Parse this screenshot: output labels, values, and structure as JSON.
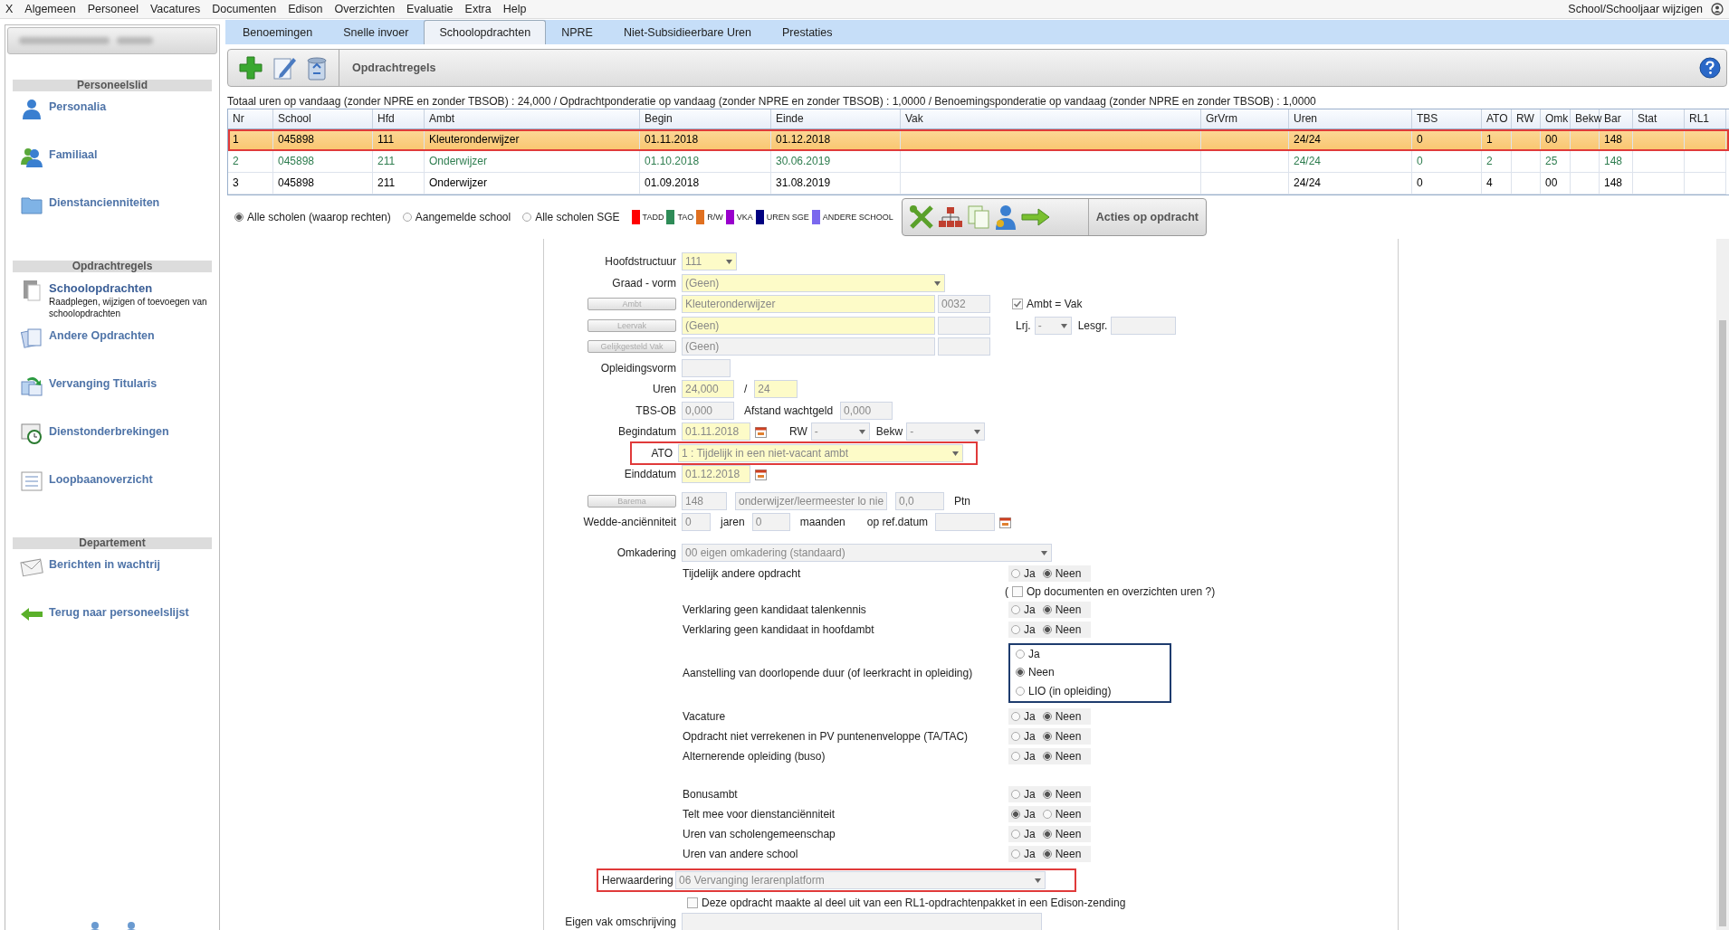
{
  "menu": [
    "X",
    "Algemeen",
    "Personeel",
    "Vacatures",
    "Documenten",
    "Edison",
    "Overzichten",
    "Evaluatie",
    "Extra",
    "Help"
  ],
  "user_link": "School/Schooljaar wijzigen",
  "sidebar": {
    "sections": [
      {
        "title": "Personeelslid",
        "items": [
          {
            "label": "Personalia",
            "selected": false
          },
          {
            "label": "Familiaal",
            "selected": false
          },
          {
            "label": "Dienstancienniteiten",
            "selected": false
          }
        ]
      },
      {
        "title": "Opdrachtregels",
        "items": [
          {
            "label": "Schoolopdrachten",
            "description": "Raadplegen, wijzigen of toevoegen van schoolopdrachten",
            "selected": true
          },
          {
            "label": "Andere Opdrachten",
            "selected": false
          },
          {
            "label": "Vervanging Titularis",
            "selected": false
          },
          {
            "label": "Dienstonderbrekingen",
            "selected": false
          },
          {
            "label": "Loopbaanoverzicht",
            "selected": false
          }
        ]
      },
      {
        "title": "Departement",
        "items": [
          {
            "label": "Berichten in wachtrij",
            "selected": false
          },
          {
            "label": "Terug naar personeelslijst",
            "selected": false
          }
        ]
      }
    ]
  },
  "tabs": [
    {
      "label": "Benoemingen",
      "selected": false
    },
    {
      "label": "Snelle invoer",
      "selected": false
    },
    {
      "label": "Schoolopdrachten",
      "selected": true
    },
    {
      "label": "NPRE",
      "selected": false
    },
    {
      "label": "Niet-Subsidieerbare Uren",
      "selected": false
    },
    {
      "label": "Prestaties",
      "selected": false
    }
  ],
  "toolbar": {
    "title": "Opdrachtregels"
  },
  "summary": "Totaal uren op vandaag (zonder NPRE en zonder TBSOB) : 24,000 / Opdrachtponderatie op vandaag (zonder NPRE en zonder TBSOB) : 1,0000 / Benoemingsponderatie op vandaag (zonder NPRE en zonder TBSOB) : 1,0000",
  "table": {
    "columns": [
      "Nr",
      "School",
      "Hfd",
      "Ambt",
      "Begin",
      "Einde",
      "Vak",
      "GrVrm",
      "Uren",
      "TBS",
      "ATO",
      "RW",
      "Omk",
      "Bekw",
      "Bar",
      "Stat",
      "RL1"
    ],
    "rows": [
      {
        "cells": [
          "1",
          "045898",
          "111",
          "Kleuteronderwijzer",
          "01.11.2018",
          "01.12.2018",
          "",
          "",
          "24/24",
          "0",
          "1",
          "",
          "00",
          "",
          "148",
          "",
          ""
        ],
        "selected": true,
        "marked": true,
        "color": "#000000"
      },
      {
        "cells": [
          "2",
          "045898",
          "211",
          "Onderwijzer",
          "01.10.2018",
          "30.06.2019",
          "",
          "",
          "24/24",
          "0",
          "2",
          "",
          "25",
          "",
          "148",
          "",
          ""
        ],
        "selected": false,
        "marked": false,
        "color": "#2e7d4f"
      },
      {
        "cells": [
          "3",
          "045898",
          "211",
          "Onderwijzer",
          "01.09.2018",
          "31.08.2019",
          "",
          "",
          "24/24",
          "0",
          "4",
          "",
          "00",
          "",
          "148",
          "",
          ""
        ],
        "selected": false,
        "marked": false,
        "color": "#000000"
      }
    ]
  },
  "school_filter": [
    {
      "label": "Alle scholen (waarop rechten)",
      "selected": true
    },
    {
      "label": "Aangemelde school",
      "selected": false
    },
    {
      "label": "Alle scholen SGE",
      "selected": false
    }
  ],
  "legend": [
    {
      "label": "TADD",
      "color": "#ff0000"
    },
    {
      "label": "TAO",
      "color": "#2e8b57"
    },
    {
      "label": "R/W",
      "color": "#e07020"
    },
    {
      "label": "VKA",
      "color": "#9900cc"
    },
    {
      "label": "UREN SGE",
      "color": "#000080"
    },
    {
      "label": "ANDERE SCHOOL",
      "color": "#7b68ee"
    }
  ],
  "actions_button": "Acties op opdracht",
  "form": {
    "hoofdstructuur": {
      "label": "Hoofdstructuur",
      "value": "111",
      "required": true
    },
    "graad_vorm": {
      "label": "Graad - vorm",
      "value": "(Geen)",
      "required": true
    },
    "ambt": {
      "button": "Ambt",
      "value": "Kleuteronderwijzer",
      "code": "0032",
      "required": true
    },
    "ambt_is_vak": {
      "label": "Ambt = Vak",
      "checked": true
    },
    "leervak": {
      "button": "Leervak",
      "value": "(Geen)",
      "required": true
    },
    "lrj": {
      "label": "Lrj.",
      "value": "-"
    },
    "lesgr": {
      "label": "Lesgr."
    },
    "gelijkgesteld_vak": {
      "button": "Gelijkgesteld Vak",
      "value": "(Geen)",
      "required": false
    },
    "opleidingsvorm": {
      "label": "Opleidingsvorm"
    },
    "uren": {
      "label": "Uren",
      "value": "24,000",
      "separator": "/",
      "total": "24"
    },
    "tbs_ob": {
      "label": "TBS-OB",
      "value": "0,000"
    },
    "afstand_wachtgeld": {
      "label": "Afstand wachtgeld",
      "value": "0,000"
    },
    "begindatum": {
      "label": "Begindatum",
      "value": "01.11.2018"
    },
    "rw": {
      "label": "RW",
      "value": "-"
    },
    "bekw": {
      "label": "Bekw",
      "value": "-"
    },
    "ato": {
      "label": "ATO",
      "value": "1 : Tijdelijk in een niet-vacant ambt",
      "marked": true
    },
    "einddatum": {
      "label": "Einddatum",
      "value": "01.12.2018"
    },
    "barema": {
      "button": "Barema",
      "value": "148",
      "description": "onderwijzer/leermeester lo nie",
      "points": "0,0",
      "unit": "Ptn"
    },
    "wedde": {
      "label": "Wedde-anciënniteit",
      "years": "0",
      "years_label": "jaren",
      "months": "0",
      "months_label": "maanden",
      "ref_label": "op ref.datum"
    },
    "omkadering": {
      "label": "Omkadering",
      "value": "00 eigen omkadering (standaard)"
    },
    "question_groups": [
      [
        {
          "kind": "inline",
          "label": "Tijdelijk andere opdracht",
          "options": [
            {
              "label": "Ja",
              "selected": false
            },
            {
              "label": "Neen",
              "selected": true
            }
          ],
          "note_prefix": "(",
          "note": "Op documenten en overzichten uren ?)",
          "note_checked": false
        },
        {
          "kind": "inline",
          "label": "Verklaring geen kandidaat talenkennis",
          "options": [
            {
              "label": "Ja",
              "selected": false
            },
            {
              "label": "Neen",
              "selected": true
            }
          ]
        },
        {
          "kind": "inline",
          "label": "Verklaring geen kandidaat in hoofdambt",
          "options": [
            {
              "label": "Ja",
              "selected": false
            },
            {
              "label": "Neen",
              "selected": true
            }
          ]
        },
        {
          "kind": "boxed",
          "label": "Aanstelling van doorlopende duur (of leerkracht in opleiding)",
          "options": [
            {
              "label": "Ja",
              "selected": false
            },
            {
              "label": "Neen",
              "selected": true
            },
            {
              "label": "LIO (in opleiding)",
              "selected": false
            }
          ]
        },
        {
          "kind": "inline",
          "label": "Vacature",
          "options": [
            {
              "label": "Ja",
              "selected": false
            },
            {
              "label": "Neen",
              "selected": true
            }
          ]
        },
        {
          "kind": "inline",
          "label": "Opdracht niet verrekenen in PV puntenenveloppe (TA/TAC)",
          "options": [
            {
              "label": "Ja",
              "selected": false
            },
            {
              "label": "Neen",
              "selected": true
            }
          ]
        },
        {
          "kind": "inline",
          "label": "Alternerende opleiding (buso)",
          "options": [
            {
              "label": "Ja",
              "selected": false
            },
            {
              "label": "Neen",
              "selected": true
            }
          ]
        }
      ],
      [
        {
          "kind": "inline",
          "label": "Bonusambt",
          "options": [
            {
              "label": "Ja",
              "selected": false
            },
            {
              "label": "Neen",
              "selected": true
            }
          ]
        },
        {
          "kind": "inline",
          "label": "Telt mee voor dienstanciënniteit",
          "options": [
            {
              "label": "Ja",
              "selected": true
            },
            {
              "label": "Neen",
              "selected": false
            }
          ]
        },
        {
          "kind": "inline",
          "label": "Uren van scholengemeenschap",
          "options": [
            {
              "label": "Ja",
              "selected": false
            },
            {
              "label": "Neen",
              "selected": true
            }
          ]
        },
        {
          "kind": "inline",
          "label": "Uren van andere school",
          "options": [
            {
              "label": "Ja",
              "selected": false
            },
            {
              "label": "Neen",
              "selected": true
            }
          ]
        }
      ]
    ],
    "herwaardering": {
      "label": "Herwaardering",
      "value": "06 Vervanging lerarenplatform",
      "marked": true
    },
    "rl1": {
      "label": "Deze opdracht maakte al deel uit van een RL1-opdrachtenpakket in een Edison-zending",
      "checked": false
    },
    "eigen_vak": {
      "label": "Eigen vak omschrijving"
    }
  }
}
